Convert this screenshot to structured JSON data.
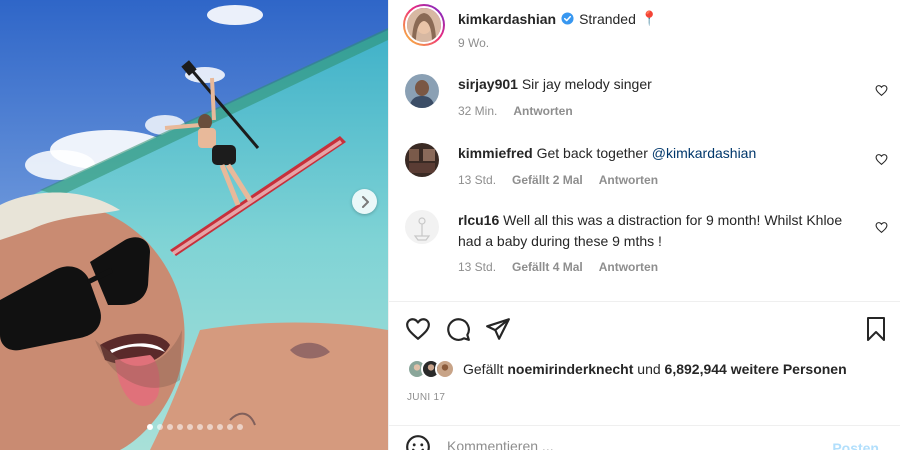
{
  "post": {
    "username": "kimkardashian",
    "caption": "Stranded",
    "caption_emoji": "📍",
    "time": "9 Wo."
  },
  "comments": [
    {
      "username": "sirjay901",
      "text": "Sir jay melody singer",
      "time": "32 Min.",
      "likes": "",
      "reply": "Antworten"
    },
    {
      "username": "kimmiefred",
      "text": "Get back together ",
      "mention": "@kimkardashian",
      "time": "13 Std.",
      "likes": "Gefällt 2 Mal",
      "reply": "Antworten"
    },
    {
      "username": "rlcu16",
      "text": "Well all this was a distraction for 9 month! Whilst Khloe had a baby during these 9 mths !",
      "time": "13 Std.",
      "likes": "Gefällt 4 Mal",
      "reply": "Antworten"
    }
  ],
  "likes": {
    "prefix": "Gefällt",
    "liker": "noemirinderknecht",
    "joiner": "und",
    "others": "6,892,944 weitere Personen"
  },
  "date": "JUNI 17",
  "comment_input": {
    "placeholder": "Kommentieren ...",
    "post_label": "Posten"
  },
  "carousel": {
    "slides": 10,
    "active": 1
  },
  "colors": {
    "verified": "#3897f0",
    "link": "#00376b",
    "post_button_disabled": "#b2dffc",
    "meta": "#8e8e8e"
  },
  "icons": [
    "heart-icon",
    "comment-icon",
    "share-icon",
    "bookmark-icon",
    "emoji-icon",
    "chevron-right-icon",
    "verified-badge-icon"
  ]
}
